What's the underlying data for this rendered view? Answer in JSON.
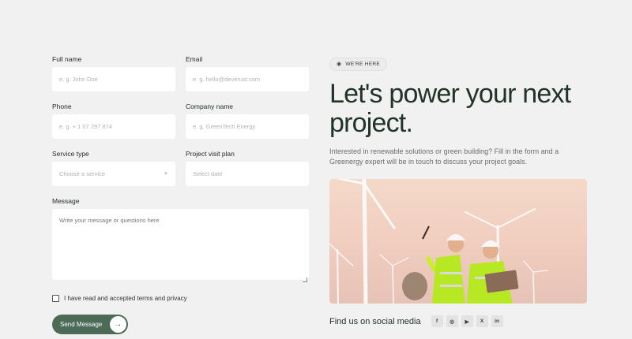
{
  "form": {
    "full_name": {
      "label": "Full name",
      "placeholder": "e. g. John Doe"
    },
    "email": {
      "label": "Email",
      "placeholder": "e. g. hello@deverust.com"
    },
    "phone": {
      "label": "Phone",
      "placeholder": "e. g. + 1 07 297 874"
    },
    "company": {
      "label": "Company name",
      "placeholder": "e. g. GreenTech Energy"
    },
    "service": {
      "label": "Service type",
      "placeholder": "Choose a service"
    },
    "visit": {
      "label": "Project visit plan",
      "placeholder": "Select date"
    },
    "message": {
      "label": "Message",
      "placeholder": "Write your message or questions here"
    },
    "terms_text": "I have read and accepted terms and privacy",
    "send_label": "Send Message",
    "send_icon": "arrow-right-icon"
  },
  "hero": {
    "badge": "WE'RE HERE",
    "badge_icon": "globe-icon",
    "headline": "Let's power your next project.",
    "description": "Interested in renewable solutions or green building? Fill in the form and a Greenergy expert will be in touch to discuss your project goals."
  },
  "social": {
    "title": "Find us on social media",
    "icons": [
      {
        "name": "facebook-icon",
        "glyph": "f"
      },
      {
        "name": "instagram-icon",
        "glyph": "◎"
      },
      {
        "name": "youtube-icon",
        "glyph": "▶"
      },
      {
        "name": "x-icon",
        "glyph": "X"
      },
      {
        "name": "linkedin-icon",
        "glyph": "in"
      }
    ]
  },
  "colors": {
    "background": "#f1f1f1",
    "accent": "#4b6b56",
    "headline": "#223328"
  }
}
